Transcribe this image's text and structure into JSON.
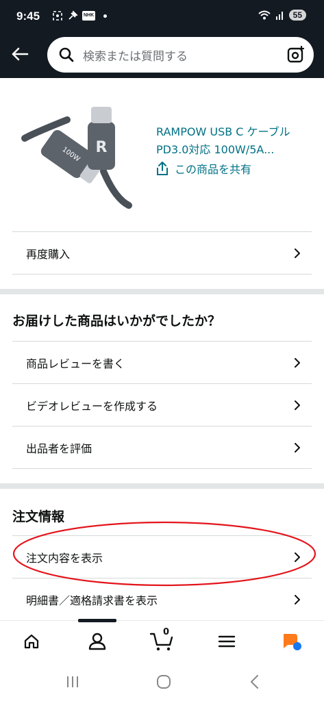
{
  "status_bar": {
    "time": "9:45",
    "nhk_label": "NHK",
    "battery": "55"
  },
  "header": {
    "search_placeholder": "検索または質問する"
  },
  "product": {
    "title": "RAMPOW USB C ケーブル PD3.0対応 100W/5A...",
    "share_label": "この商品を共有"
  },
  "actions": {
    "buy_again": "再度購入"
  },
  "feedback": {
    "heading": "お届けした商品はいかがでしたか？",
    "items": [
      {
        "label": "商品レビューを書く"
      },
      {
        "label": "ビデオレビューを作成する"
      },
      {
        "label": "出品者を評価"
      }
    ]
  },
  "order_info": {
    "heading": "注文情報",
    "items": [
      {
        "label": "注文内容を表示"
      },
      {
        "label": "明細書／適格請求書を表示"
      }
    ]
  },
  "bottom_nav": {
    "cart_count": "0",
    "items": [
      "home-icon",
      "account-icon",
      "cart-icon",
      "menu-icon",
      "ai-assistant-icon"
    ]
  },
  "colors": {
    "header_bg": "#131a22",
    "link": "#007185",
    "highlight": "#e3141b",
    "ai_orange": "#ff7a1a",
    "ai_blue": "#1877f2"
  }
}
